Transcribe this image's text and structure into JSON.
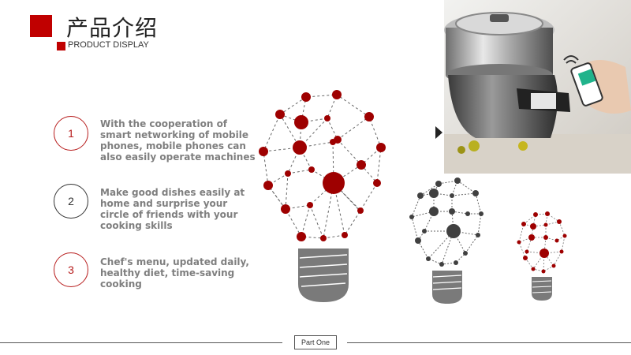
{
  "header": {
    "title": "产品介绍",
    "subtitle": "PRODUCT DISPLAY"
  },
  "items": [
    {
      "number": "1",
      "text": "With the cooperation of smart networking of mobile phones, mobile phones can also easily operate machines"
    },
    {
      "number": "2",
      "text": "Make good dishes easily at home and surprise your circle of friends with your cooking skills"
    },
    {
      "number": "3",
      "text": "Chef's menu, updated daily, healthy diet, time-saving cooking"
    }
  ],
  "photo": {
    "subject": "smart cooking machine controlled by smartphone"
  },
  "bulbs": [
    {
      "color": "#9e0000",
      "base_color": "#7a7a7a"
    },
    {
      "color": "#404040",
      "base_color": "#7a7a7a"
    },
    {
      "color": "#9e0000",
      "base_color": "#7a7a7a"
    }
  ],
  "footer": {
    "label": "Part One"
  },
  "colors": {
    "accent": "#c00000",
    "text_gray": "#7f7f7f"
  }
}
